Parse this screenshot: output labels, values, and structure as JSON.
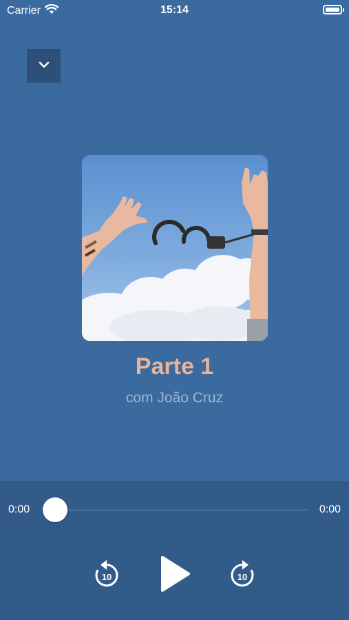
{
  "status_bar": {
    "carrier": "Carrier",
    "time": "15:14",
    "battery_level": 1.0
  },
  "header": {
    "collapse_icon": "chevron-down-icon"
  },
  "now_playing": {
    "title": "Parte 1",
    "artist": "com João Cruz",
    "artwork_icon": "handcuffs-sky-artwork"
  },
  "player": {
    "elapsed": "0:00",
    "total": "0:00",
    "progress": 0.0,
    "rewind_seconds": "10",
    "forward_seconds": "10",
    "rewind_icon": "rewind-10-icon",
    "play_icon": "play-icon",
    "forward_icon": "forward-10-icon"
  },
  "colors": {
    "background": "#3a6a9e",
    "panel": "#325b8a",
    "title_accent": "#e6b49b",
    "subtitle": "#9cb6d3"
  }
}
